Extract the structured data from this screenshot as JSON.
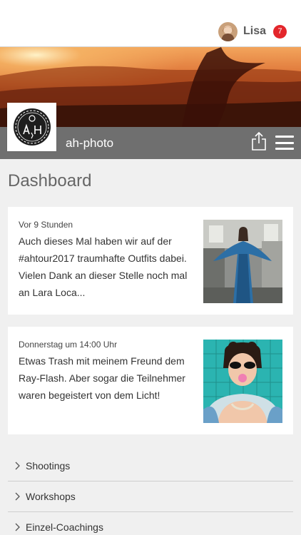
{
  "header": {
    "user_name": "Lisa",
    "notification_count": "7",
    "badge_color": "#e3262b"
  },
  "brand": {
    "name": "ah-photo",
    "bar_color": "#6f6f6f"
  },
  "page": {
    "title": "Dashboard"
  },
  "posts": [
    {
      "time": "Vor 9 Stunden",
      "text": "Auch dieses Mal haben wir auf der #ahtour2017 traumhafte Outfits dabei. Vielen Dank an dieser Stelle noch mal an Lara Loca..."
    },
    {
      "time": "Donnerstag um 14:00 Uhr",
      "text": "Etwas Trash mit meinem Freund dem Ray-Flash. Aber sogar die Teilnehmer waren begeistert von dem Licht!"
    }
  ],
  "menu": [
    {
      "label": "Shootings"
    },
    {
      "label": "Workshops"
    },
    {
      "label": "Einzel-Coachings"
    }
  ]
}
